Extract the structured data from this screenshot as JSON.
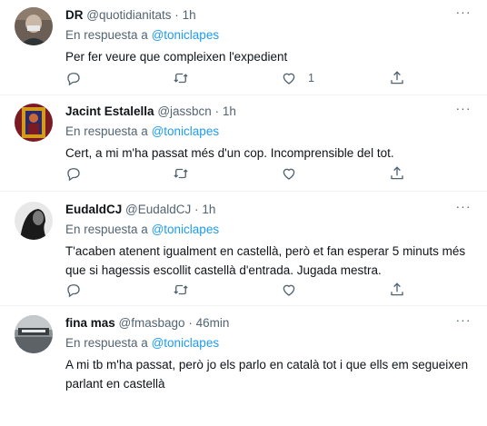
{
  "tweets": [
    {
      "name": "DR",
      "handle": "@quotidianitats",
      "time": "1h",
      "reply_prefix": "En respuesta a",
      "reply_to": "@toniclapes",
      "text_lines": [
        "Per fer veure que compleixen l'expedient"
      ],
      "like_count": "1",
      "avatar_colors": [
        "#6b5e55",
        "#c9b8a8",
        "#2f3437"
      ]
    },
    {
      "name": "Jacint Estalella",
      "handle": "@jassbcn",
      "time": "1h",
      "reply_prefix": "En respuesta a",
      "reply_to": "@toniclapes",
      "text_lines": [
        "Cert, a mi m'ha passat més d'un cop. Incomprensible del tot."
      ],
      "like_count": "",
      "avatar_colors": [
        "#7a1a22",
        "#d49a1a",
        "#2a2a6a"
      ]
    },
    {
      "name": "EudaldCJ",
      "handle": "@EudaldCJ",
      "time": "1h",
      "reply_prefix": "En respuesta a",
      "reply_to": "@toniclapes",
      "text_lines": [
        "T'acaben atenent igualment en castellà, però et fan esperar 5 minuts més",
        "que si hagessis escollit castellà d'entrada. Jugada mestra."
      ],
      "like_count": "",
      "avatar_colors": [
        "#1a1a1a",
        "#e8e8e8",
        "#7a7a7a"
      ]
    },
    {
      "name": "fina mas",
      "handle": "@fmasbago",
      "time": "46min",
      "reply_prefix": "En respuesta a",
      "reply_to": "@toniclapes",
      "text_lines": [
        "A mi tb m'ha passat, però jo els parlo en català tot i que ells em segueixen",
        "parlant en castellà"
      ],
      "like_count": "",
      "avatar_colors": [
        "#8a8f94",
        "#3a3f44",
        "#c5c9cc"
      ]
    }
  ],
  "separator": "·",
  "more_label": "···",
  "colors": {
    "accent": "#1d9bf0",
    "muted": "#536471",
    "text": "#0f1419",
    "border": "#eff3f4"
  },
  "icons": [
    "reply-icon",
    "retweet-icon",
    "like-icon",
    "share-icon",
    "more-icon"
  ]
}
